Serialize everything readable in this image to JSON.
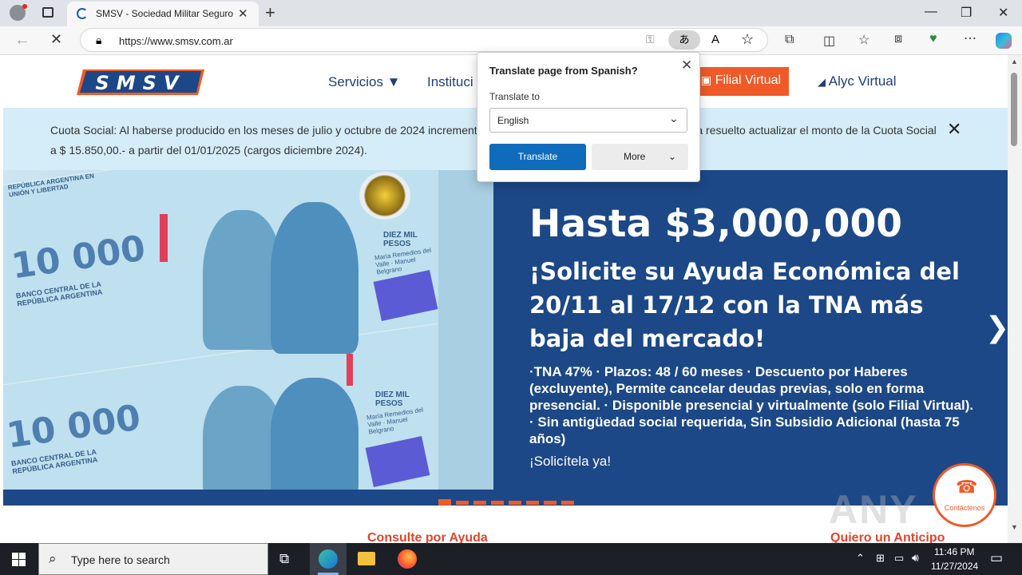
{
  "browser": {
    "tab_title": "SMSV - Sociedad Militar Seguro de Vida",
    "tab_close": "✕",
    "new_tab": "+",
    "url": "https://www.smsv.com.ar",
    "window_controls": {
      "minimize": "—",
      "restore": "❐",
      "close": "✕"
    }
  },
  "site": {
    "logo_text": "SMSV",
    "nav": {
      "servicios": "Servicios ▼",
      "institucional": "Instituci",
      "filial_virtual": "Filial Virtual",
      "alyc_virtual": "Alyc Virtual"
    },
    "notice": {
      "text": "Cuota Social: Al haberse producido en los meses de julio y octubre de 2024 incrementos en los haberes militares, esta Sociedad ha resuelto actualizar el monto de la Cuota Social a $ 15.850,00.- a partir del 01/01/2025 (cargos diciembre 2024).",
      "close": "✕"
    },
    "hero": {
      "headline": "Hasta $3,000,000",
      "subheadline": "¡Solicite su Ayuda Económica del 20/11 al 17/12 con la TNA más baja del mercado!",
      "description": "·TNA 47% · Plazos: 48 / 60 meses · Descuento por Haberes (excluyente), Permite cancelar deudas previas, solo en forma presencial. · Disponible presencial y virtualmente (solo Filial Virtual). · Sin antigüedad social requerida, Sin Subsidio Adicional (hasta 75 años)",
      "cta": "¡Solicítela ya!",
      "next": "❯",
      "bill_text": {
        "value": "10 000",
        "bank": "BANCO CENTRAL DE LA REPÚBLICA ARGENTINA",
        "diez_mil": "DIEZ MIL PESOS",
        "names": "María Remedios del Valle · Manuel Belgrano",
        "republica": "REPÚBLICA ARGENTINA EN UNIÓN Y LIBERTAD"
      }
    },
    "slides_total": 8,
    "slide_active": 1,
    "bottom_links": {
      "left": "Consulte por Ayuda",
      "right": "Quiero un Anticipo"
    },
    "contact": "Contáctenos",
    "watermark": "ANY RUN"
  },
  "translate_popup": {
    "title": "Translate page from Spanish?",
    "label": "Translate to",
    "selected_language": "English",
    "translate_button": "Translate",
    "more_button": "More",
    "close": "✕"
  },
  "taskbar": {
    "search_placeholder": "Type here to search",
    "time": "11:46 PM",
    "date": "11/27/2024"
  },
  "colors": {
    "brand_blue": "#1c4887",
    "brand_orange": "#f05a28",
    "notice_bg": "#d5ecf9",
    "edge_blue": "#0f6cbd"
  }
}
